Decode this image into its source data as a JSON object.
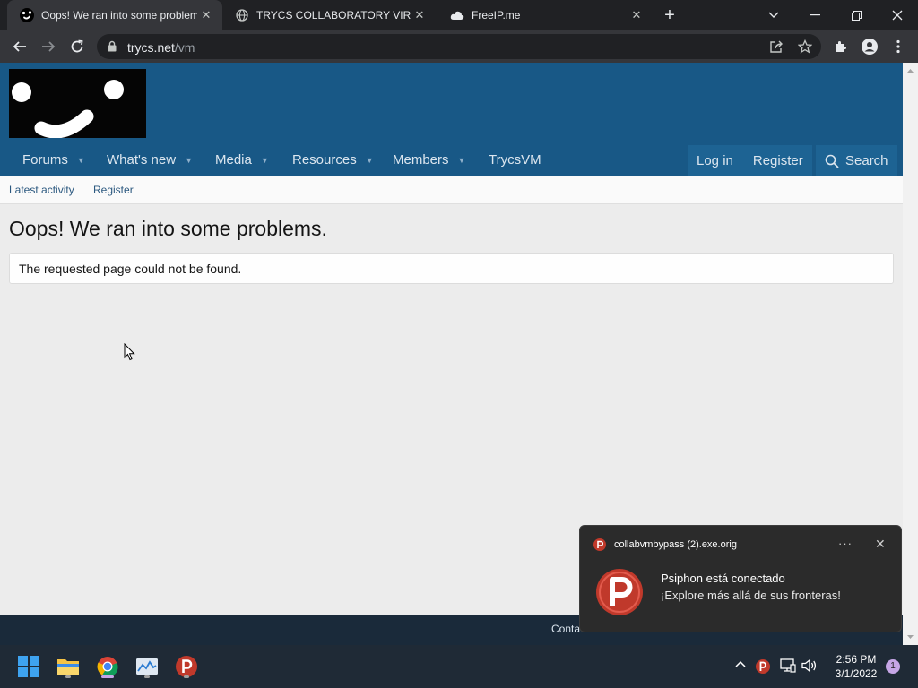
{
  "browser": {
    "tabs": [
      {
        "title": "Oops! We ran into some problem",
        "active": true
      },
      {
        "title": "TRYCS COLLABORATORY VIRTUA",
        "active": false
      },
      {
        "title": "FreeIP.me",
        "active": false
      }
    ],
    "url_domain": "trycs.net",
    "url_path": "/vm"
  },
  "site": {
    "nav": [
      {
        "label": "Forums",
        "caret": true
      },
      {
        "label": "What's new",
        "caret": true
      },
      {
        "label": "Media",
        "caret": true
      },
      {
        "label": "Resources",
        "caret": true
      },
      {
        "label": "Members",
        "caret": true
      },
      {
        "label": "TrycsVM",
        "caret": false
      }
    ],
    "login_label": "Log in",
    "register_label": "Register",
    "search_label": "Search",
    "subnav": [
      "Latest activity",
      "Register"
    ],
    "heading": "Oops! We ran into some problems.",
    "message": "The requested page could not be found.",
    "footer_text": "Conta"
  },
  "notification": {
    "app_name": "collabvmbypass (2).exe.orig",
    "title": "Psiphon está conectado",
    "body": "¡Explore más allá de sus fronteras!",
    "more": "···",
    "close": "✕"
  },
  "taskbar": {
    "time": "2:56 PM",
    "date": "3/1/2022",
    "notification_count": "1"
  },
  "colors": {
    "header": "#185886",
    "footer": "#1a2a3a",
    "psiphon": "#c0392b"
  }
}
